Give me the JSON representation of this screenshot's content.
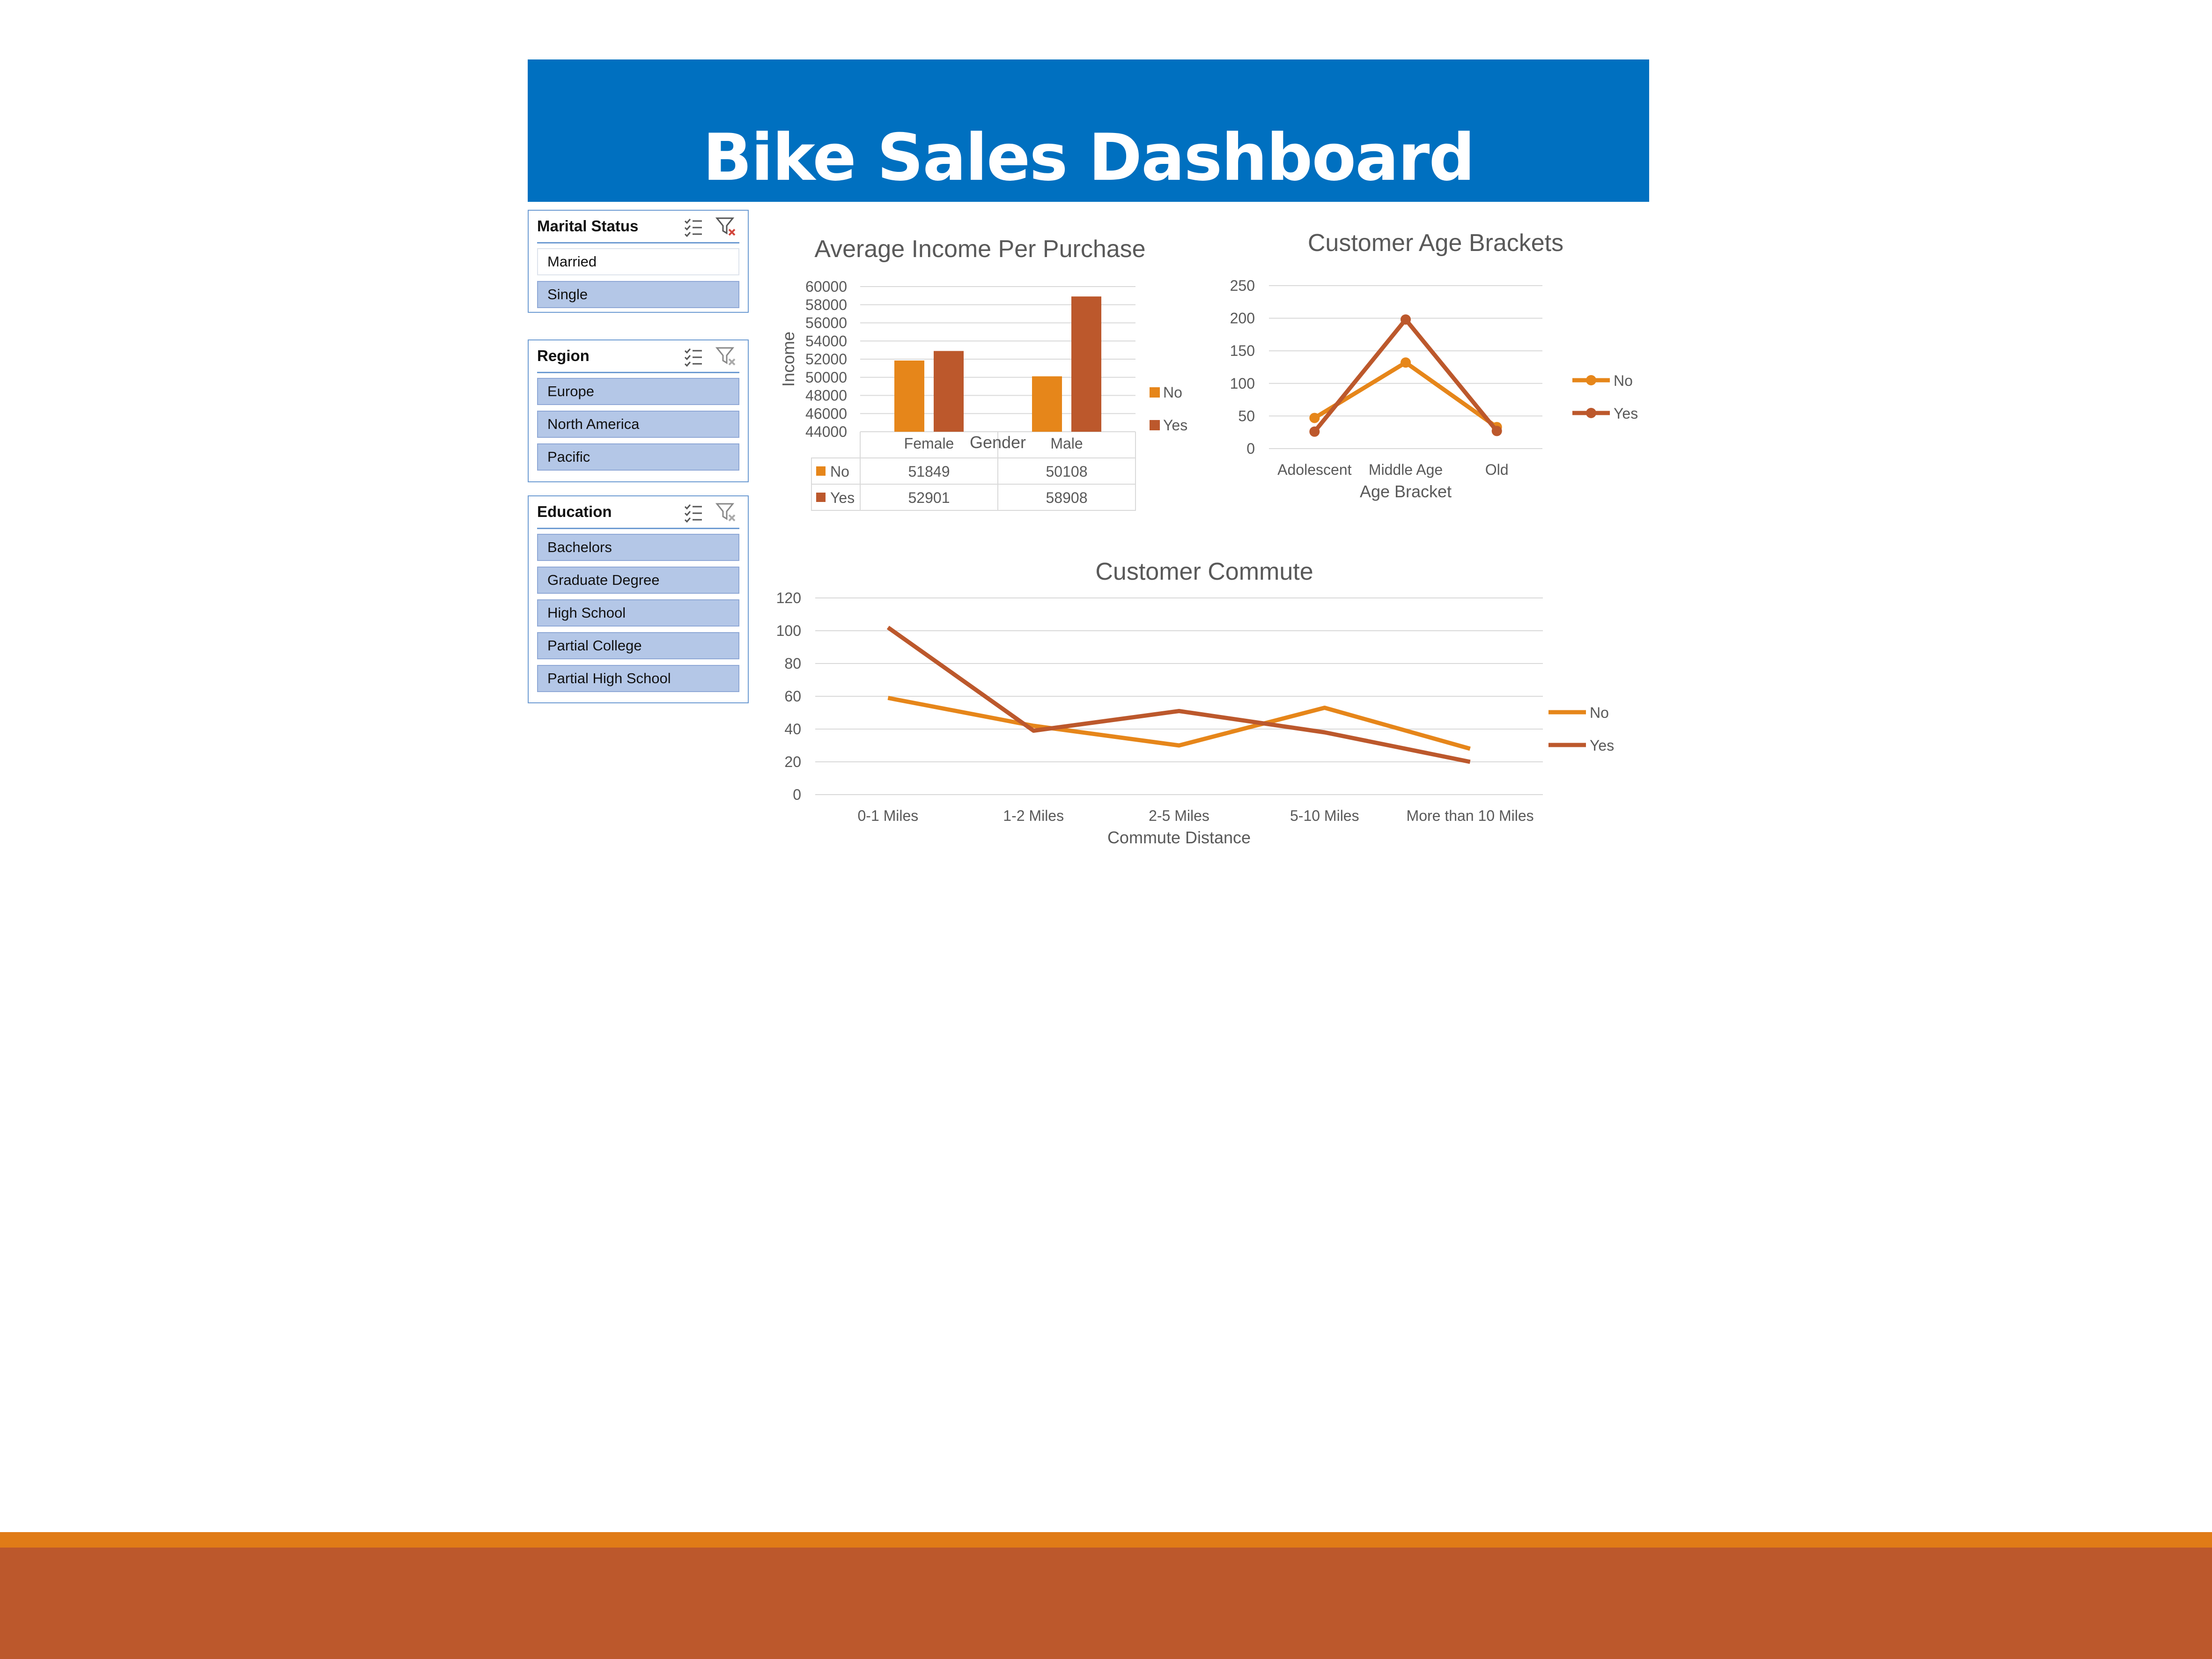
{
  "dashboard": {
    "title": "Bike Sales Dashboard"
  },
  "colors": {
    "banner": "#0070c0",
    "no": "#e6861a",
    "yes": "#bc582c",
    "footer_stripe": "#e07b17",
    "footer_bar": "#bc582c",
    "slicer_selected": "#b4c7e7"
  },
  "slicers": {
    "marital": {
      "title": "Marital Status",
      "items": [
        {
          "label": "Married",
          "selected": false
        },
        {
          "label": "Single",
          "selected": true
        }
      ]
    },
    "region": {
      "title": "Region",
      "items": [
        {
          "label": "Europe",
          "selected": true
        },
        {
          "label": "North America",
          "selected": true
        },
        {
          "label": "Pacific",
          "selected": true
        }
      ]
    },
    "education": {
      "title": "Education",
      "items": [
        {
          "label": "Bachelors",
          "selected": true
        },
        {
          "label": "Graduate Degree",
          "selected": true
        },
        {
          "label": "High School",
          "selected": true
        },
        {
          "label": "Partial College",
          "selected": true
        },
        {
          "label": "Partial High School",
          "selected": true
        }
      ]
    },
    "icons": {
      "multiselect": "multi-select-icon",
      "clear_filter": "clear-filter-icon"
    }
  },
  "chart_data": [
    {
      "type": "bar",
      "title": "Average Income Per Purchase",
      "xlabel": "Gender",
      "ylabel": "Income",
      "categories": [
        "Female",
        "Male"
      ],
      "series": [
        {
          "name": "No",
          "values": [
            51849,
            50108
          ]
        },
        {
          "name": "Yes",
          "values": [
            52901,
            58908
          ]
        }
      ],
      "ylim": [
        44000,
        60000
      ],
      "yticks": [
        "60000",
        "58000",
        "56000",
        "54000",
        "52000",
        "50000",
        "48000",
        "46000",
        "44000"
      ],
      "data_table": {
        "rows": [
          {
            "name": "No",
            "values": [
              "51849",
              "50108"
            ]
          },
          {
            "name": "Yes",
            "values": [
              "52901",
              "58908"
            ]
          }
        ]
      },
      "legend": "right",
      "grid": true
    },
    {
      "type": "line",
      "title": "Customer Age Brackets",
      "xlabel": "Age Bracket",
      "ylabel": "",
      "categories": [
        "Adolescent",
        "Middle Age",
        "Old"
      ],
      "series": [
        {
          "name": "No",
          "values": [
            47,
            132,
            33
          ]
        },
        {
          "name": "Yes",
          "values": [
            26,
            198,
            27
          ]
        }
      ],
      "ylim": [
        0,
        250
      ],
      "yticks": [
        "250",
        "200",
        "150",
        "100",
        "50",
        "0"
      ],
      "markers": true,
      "legend": "right",
      "grid": true
    },
    {
      "type": "line",
      "title": "Customer Commute",
      "xlabel": "Commute Distance",
      "ylabel": "",
      "categories": [
        "0-1 Miles",
        "1-2 Miles",
        "2-5 Miles",
        "5-10 Miles",
        "More than 10 Miles"
      ],
      "series": [
        {
          "name": "No",
          "values": [
            59,
            42,
            30,
            53,
            28
          ]
        },
        {
          "name": "Yes",
          "values": [
            102,
            39,
            51,
            38,
            20
          ]
        }
      ],
      "ylim": [
        0,
        120
      ],
      "yticks": [
        "120",
        "100",
        "80",
        "60",
        "40",
        "20",
        "0"
      ],
      "markers": false,
      "legend": "right",
      "grid": true
    }
  ]
}
